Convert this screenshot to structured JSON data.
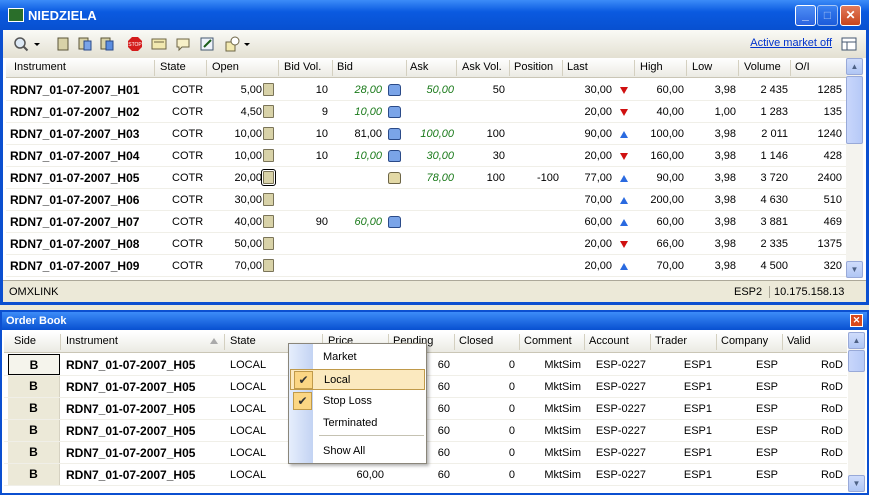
{
  "window": {
    "title": "NIEDZIELA",
    "min": "_",
    "max": "□",
    "close": "✕"
  },
  "toolbar": {
    "active_market": "Active market off"
  },
  "market": {
    "columns": [
      "Instrument",
      "State",
      "Open",
      "Bid Vol.",
      "Bid",
      "Ask",
      "Ask Vol.",
      "Position",
      "Last",
      "High",
      "Low",
      "Volume",
      "O/I"
    ],
    "rows": [
      {
        "inst": "RDN7_01-07-2007_H01",
        "state": "COTR",
        "open": "5,00",
        "bidvol": "10",
        "bid": "28,00",
        "ask": "50,00",
        "askvol": "50",
        "pos": "",
        "last": "30,00",
        "dir": "down",
        "high": "60,00",
        "low": "3,98",
        "vol": "2 435",
        "oi": "1285"
      },
      {
        "inst": "RDN7_01-07-2007_H02",
        "state": "COTR",
        "open": "4,50",
        "bidvol": "9",
        "bid": "10,00",
        "ask": "",
        "askvol": "",
        "pos": "",
        "last": "20,00",
        "dir": "down",
        "high": "40,00",
        "low": "1,00",
        "vol": "1 283",
        "oi": "135"
      },
      {
        "inst": "RDN7_01-07-2007_H03",
        "state": "COTR",
        "open": "10,00",
        "bidvol": "10",
        "bid": "81,00",
        "ask": "100,00",
        "askvol": "100",
        "pos": "",
        "last": "90,00",
        "dir": "up",
        "high": "100,00",
        "low": "3,98",
        "vol": "2 011",
        "oi": "1240"
      },
      {
        "inst": "RDN7_01-07-2007_H04",
        "state": "COTR",
        "open": "10,00",
        "bidvol": "10",
        "bid": "10,00",
        "ask": "30,00",
        "askvol": "30",
        "pos": "",
        "last": "20,00",
        "dir": "down",
        "high": "160,00",
        "low": "3,98",
        "vol": "1 146",
        "oi": "428"
      },
      {
        "inst": "RDN7_01-07-2007_H05",
        "state": "COTR",
        "open": "20,00",
        "bidvol": "",
        "bid": "",
        "ask": "78,00",
        "askvol": "100",
        "pos": "-100",
        "last": "77,00",
        "dir": "up",
        "high": "90,00",
        "low": "3,98",
        "vol": "3 720",
        "oi": "2400"
      },
      {
        "inst": "RDN7_01-07-2007_H06",
        "state": "COTR",
        "open": "30,00",
        "bidvol": "",
        "bid": "",
        "ask": "",
        "askvol": "",
        "pos": "",
        "last": "70,00",
        "dir": "up",
        "high": "200,00",
        "low": "3,98",
        "vol": "4 630",
        "oi": "510"
      },
      {
        "inst": "RDN7_01-07-2007_H07",
        "state": "COTR",
        "open": "40,00",
        "bidvol": "90",
        "bid": "60,00",
        "ask": "",
        "askvol": "",
        "pos": "",
        "last": "60,00",
        "dir": "up",
        "high": "60,00",
        "low": "3,98",
        "vol": "3 881",
        "oi": "469"
      },
      {
        "inst": "RDN7_01-07-2007_H08",
        "state": "COTR",
        "open": "50,00",
        "bidvol": "",
        "bid": "",
        "ask": "",
        "askvol": "",
        "pos": "",
        "last": "20,00",
        "dir": "down",
        "high": "66,00",
        "low": "3,98",
        "vol": "2 335",
        "oi": "1375"
      },
      {
        "inst": "RDN7_01-07-2007_H09",
        "state": "COTR",
        "open": "70,00",
        "bidvol": "",
        "bid": "",
        "ask": "",
        "askvol": "",
        "pos": "",
        "last": "20,00",
        "dir": "up",
        "high": "70,00",
        "low": "3,98",
        "vol": "4 500",
        "oi": "320"
      }
    ]
  },
  "status": {
    "left": "OMXLINK",
    "esp": "ESP2",
    "ip": "10.175.158.13"
  },
  "orderbook": {
    "title": "Order Book",
    "columns": [
      "Side",
      "Instrument",
      "State",
      "Price",
      "Pending",
      "Closed",
      "Comment",
      "Account",
      "Trader",
      "Company",
      "Valid"
    ],
    "rows": [
      {
        "side": "B",
        "inst": "RDN7_01-07-2007_H05",
        "state": "LOCAL",
        "price": "",
        "pending": "60",
        "closed": "0",
        "comment": "MktSim",
        "account": "ESP-0227",
        "trader": "ESP1",
        "company": "ESP",
        "valid": "RoD"
      },
      {
        "side": "B",
        "inst": "RDN7_01-07-2007_H05",
        "state": "LOCAL",
        "price": "",
        "pending": "60",
        "closed": "0",
        "comment": "MktSim",
        "account": "ESP-0227",
        "trader": "ESP1",
        "company": "ESP",
        "valid": "RoD"
      },
      {
        "side": "B",
        "inst": "RDN7_01-07-2007_H05",
        "state": "LOCAL",
        "price": "",
        "pending": "60",
        "closed": "0",
        "comment": "MktSim",
        "account": "ESP-0227",
        "trader": "ESP1",
        "company": "ESP",
        "valid": "RoD"
      },
      {
        "side": "B",
        "inst": "RDN7_01-07-2007_H05",
        "state": "LOCAL",
        "price": "",
        "pending": "60",
        "closed": "0",
        "comment": "MktSim",
        "account": "ESP-0227",
        "trader": "ESP1",
        "company": "ESP",
        "valid": "RoD"
      },
      {
        "side": "B",
        "inst": "RDN7_01-07-2007_H05",
        "state": "LOCAL",
        "price": "",
        "pending": "60",
        "closed": "0",
        "comment": "MktSim",
        "account": "ESP-0227",
        "trader": "ESP1",
        "company": "ESP",
        "valid": "RoD"
      },
      {
        "side": "B",
        "inst": "RDN7_01-07-2007_H05",
        "state": "LOCAL",
        "price": "60,00",
        "pending": "60",
        "closed": "0",
        "comment": "MktSim",
        "account": "ESP-0227",
        "trader": "ESP1",
        "company": "ESP",
        "valid": "RoD"
      }
    ]
  },
  "menu": {
    "items": [
      {
        "label": "Market",
        "checked": false
      },
      {
        "label": "Local",
        "checked": true
      },
      {
        "label": "Stop Loss",
        "checked": true
      },
      {
        "label": "Terminated",
        "checked": false
      },
      {
        "label": "Show All",
        "checked": false
      }
    ],
    "check_glyph": "✔"
  }
}
